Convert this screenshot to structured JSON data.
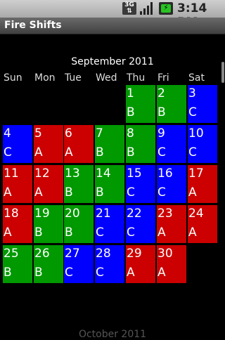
{
  "status": {
    "time": "3:14 PM",
    "network": "3G",
    "icons": [
      "network-3g-icon",
      "signal-icon",
      "battery-charging-icon"
    ]
  },
  "app": {
    "title": "Fire Shifts"
  },
  "calendar": {
    "month": "September 2011",
    "next_month": "October 2011",
    "weekdays": [
      "Sun",
      "Mon",
      "Tue",
      "Wed",
      "Thu",
      "Fri",
      "Sat"
    ],
    "colors": {
      "A": "#cc0000",
      "B": "#009900",
      "C": "#0000ff"
    },
    "days": [
      {
        "day": "1",
        "shift": "B"
      },
      {
        "day": "2",
        "shift": "B"
      },
      {
        "day": "3",
        "shift": "C"
      },
      {
        "day": "4",
        "shift": "C"
      },
      {
        "day": "5",
        "shift": "A"
      },
      {
        "day": "6",
        "shift": "A"
      },
      {
        "day": "7",
        "shift": "B"
      },
      {
        "day": "8",
        "shift": "B"
      },
      {
        "day": "9",
        "shift": "C"
      },
      {
        "day": "10",
        "shift": "C"
      },
      {
        "day": "11",
        "shift": "A"
      },
      {
        "day": "12",
        "shift": "A"
      },
      {
        "day": "13",
        "shift": "B"
      },
      {
        "day": "14",
        "shift": "B"
      },
      {
        "day": "15",
        "shift": "C"
      },
      {
        "day": "16",
        "shift": "C"
      },
      {
        "day": "17",
        "shift": "A"
      },
      {
        "day": "18",
        "shift": "A"
      },
      {
        "day": "19",
        "shift": "B"
      },
      {
        "day": "20",
        "shift": "B"
      },
      {
        "day": "21",
        "shift": "C"
      },
      {
        "day": "22",
        "shift": "C"
      },
      {
        "day": "23",
        "shift": "A"
      },
      {
        "day": "24",
        "shift": "A"
      },
      {
        "day": "25",
        "shift": "B"
      },
      {
        "day": "26",
        "shift": "B"
      },
      {
        "day": "27",
        "shift": "C"
      },
      {
        "day": "28",
        "shift": "C"
      },
      {
        "day": "29",
        "shift": "A"
      },
      {
        "day": "30",
        "shift": "A"
      }
    ]
  }
}
